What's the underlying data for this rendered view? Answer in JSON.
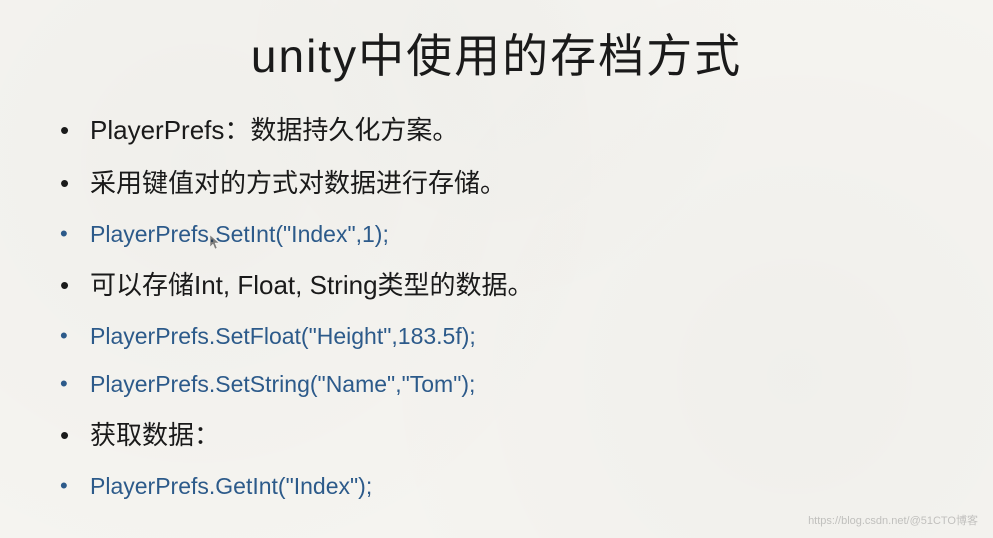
{
  "title": "unity中使用的存档方式",
  "bullets": [
    {
      "text": "PlayerPrefs：数据持久化方案。",
      "type": "text"
    },
    {
      "text": "采用键值对的方式对数据进行存储。",
      "type": "text"
    },
    {
      "text": "PlayerPrefs.SetInt(\"Index\",1);",
      "type": "code"
    },
    {
      "text": "可以存储Int, Float, String类型的数据。",
      "type": "text"
    },
    {
      "text": "PlayerPrefs.SetFloat(\"Height\",183.5f);",
      "type": "code"
    },
    {
      "text": "PlayerPrefs.SetString(\"Name\",\"Tom\");",
      "type": "code"
    },
    {
      "text": "获取数据：",
      "type": "text"
    },
    {
      "text": "PlayerPrefs.GetInt(\"Index\");",
      "type": "code"
    }
  ],
  "watermark": "https://blog.csdn.net/@51CTO博客"
}
